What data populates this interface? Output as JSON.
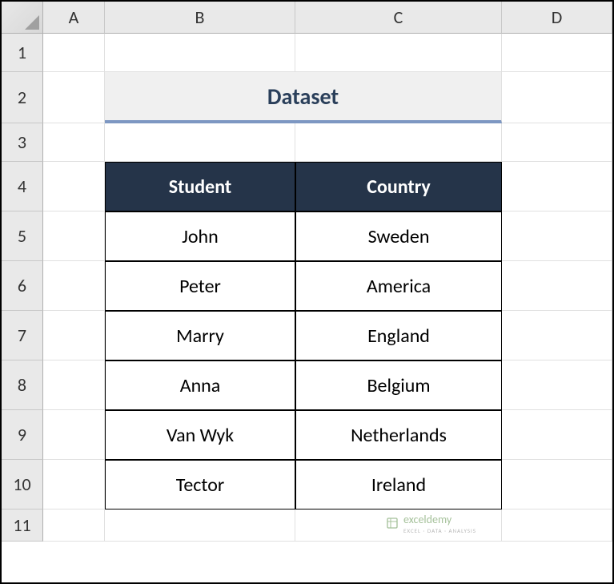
{
  "columns": [
    "A",
    "B",
    "C",
    "D"
  ],
  "rows": [
    "1",
    "2",
    "3",
    "4",
    "5",
    "6",
    "7",
    "8",
    "9",
    "10",
    "11"
  ],
  "title": "Dataset",
  "table": {
    "headers": [
      "Student",
      "Country"
    ],
    "data": [
      {
        "student": "John",
        "country": "Sweden"
      },
      {
        "student": "Peter",
        "country": "America"
      },
      {
        "student": "Marry",
        "country": "England"
      },
      {
        "student": "Anna",
        "country": "Belgium"
      },
      {
        "student": "Van Wyk",
        "country": "Netherlands"
      },
      {
        "student": "Tector",
        "country": "Ireland"
      }
    ]
  },
  "watermark": {
    "brand": "exceldemy",
    "tagline": "EXCEL · DATA · ANALYSIS"
  },
  "chart_data": {
    "type": "table",
    "title": "Dataset",
    "columns": [
      "Student",
      "Country"
    ],
    "rows": [
      [
        "John",
        "Sweden"
      ],
      [
        "Peter",
        "America"
      ],
      [
        "Marry",
        "England"
      ],
      [
        "Anna",
        "Belgium"
      ],
      [
        "Van Wyk",
        "Netherlands"
      ],
      [
        "Tector",
        "Ireland"
      ]
    ]
  }
}
